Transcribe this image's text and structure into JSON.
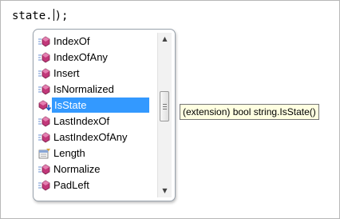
{
  "editor": {
    "code_before_caret": "state.",
    "code_after_caret": ");"
  },
  "intellisense": {
    "items": [
      {
        "label": "IndexOf",
        "icon": "extension-method-icon",
        "selected": false
      },
      {
        "label": "IndexOfAny",
        "icon": "method-icon",
        "selected": false
      },
      {
        "label": "Insert",
        "icon": "method-icon",
        "selected": false
      },
      {
        "label": "IsNormalized",
        "icon": "method-icon",
        "selected": false
      },
      {
        "label": "IsState",
        "icon": "extension-method-icon",
        "selected": true
      },
      {
        "label": "LastIndexOf",
        "icon": "method-icon",
        "selected": false
      },
      {
        "label": "LastIndexOfAny",
        "icon": "method-icon",
        "selected": false
      },
      {
        "label": "Length",
        "icon": "property-icon",
        "selected": false
      },
      {
        "label": "Normalize",
        "icon": "method-icon",
        "selected": false
      },
      {
        "label": "PadLeft",
        "icon": "method-icon",
        "selected": false
      }
    ],
    "tooltip": "(extension) bool string.IsState()",
    "colors": {
      "selection": "#3399ff",
      "method_icon": "#c2387a",
      "tooltip_bg": "#ffffe1"
    }
  }
}
